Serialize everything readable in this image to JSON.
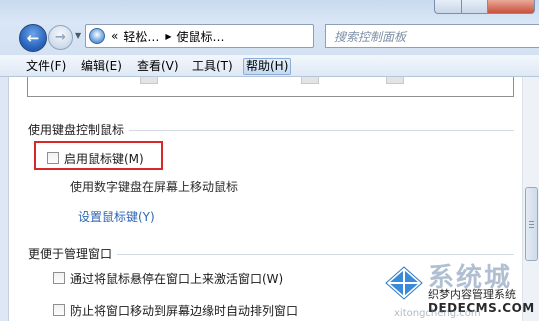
{
  "nav": {
    "back_glyph": "←",
    "forward_glyph": "→",
    "breadcrumb": [
      "轻松…",
      "使鼠标…"
    ],
    "refresh_glyph": "↻",
    "search_placeholder": "搜索控制面板"
  },
  "menu": [
    "文件(F)",
    "编辑(E)",
    "查看(V)",
    "工具(T)",
    "帮助(H)"
  ],
  "content": {
    "keyboard_section": {
      "title": "使用键盘控制鼠标",
      "mousekeys_checkbox": "启用鼠标键(M)",
      "mousekeys_checked": false,
      "mousekeys_description": "使用数字键盘在屏幕上移动鼠标",
      "setup_link": "设置鼠标键(Y)"
    },
    "windows_section": {
      "title": "更便于管理窗口",
      "option_hover_activate": "通过将鼠标悬停在窗口上来激活窗口(W)",
      "option_prevent_arrange": "防止将窗口移动到屏幕边缘时自动排列窗口"
    }
  },
  "watermark": {
    "big_text": "系统城",
    "line1": "织梦内容管理系统",
    "domain": "DEDECMS.COM",
    "faint": "xitongcheng.com"
  },
  "colors": {
    "highlight_border": "#d9282b",
    "link": "#2e66b3",
    "chrome": "#dde8f4"
  }
}
